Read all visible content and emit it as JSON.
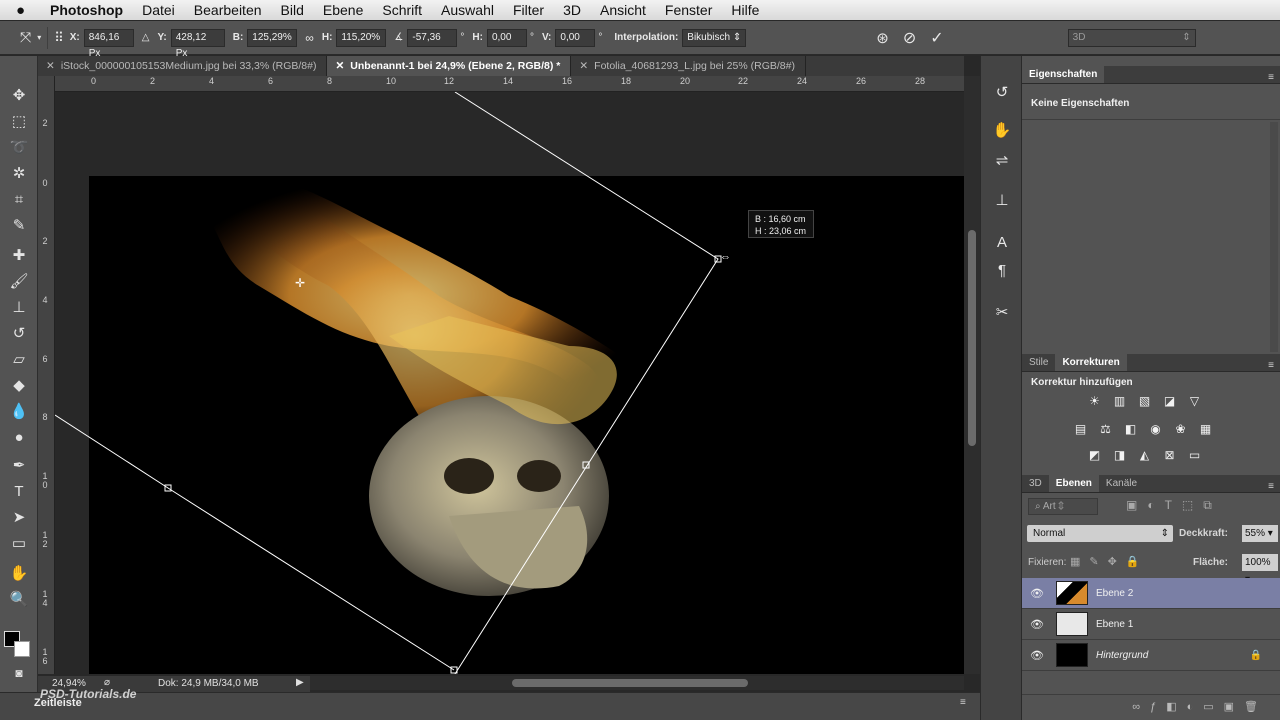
{
  "menubar": {
    "apple": "",
    "app": "Photoshop",
    "items": [
      "Datei",
      "Bearbeiten",
      "Bild",
      "Ebene",
      "Schrift",
      "Auswahl",
      "Filter",
      "3D",
      "Ansicht",
      "Fenster",
      "Hilfe"
    ]
  },
  "options": {
    "x_label": "X:",
    "x_value": "846,16 Px",
    "y_label": "Y:",
    "y_value": "428,12 Px",
    "b_label": "B:",
    "b_value": "125,29%",
    "h_label": "H:",
    "h_value": "115,20%",
    "angle_value": "-57,36",
    "deg": "°",
    "hskew_label": "H:",
    "hskew_value": "0,00",
    "vskew_label": "V:",
    "vskew_value": "0,00",
    "interp_label": "Interpolation:",
    "interp_value": "Bikubisch",
    "workspace": "3D"
  },
  "tabs": [
    {
      "label": "iStock_000000105153Medium.jpg bei 33,3% (RGB/8#)",
      "active": false
    },
    {
      "label": "Unbenannt-1 bei 24,9% (Ebene 2, RGB/8) *",
      "active": true
    },
    {
      "label": "Fotolia_40681293_L.jpg bei 25% (RGB/8#)",
      "active": false
    }
  ],
  "ruler_top": [
    "0",
    "2",
    "4",
    "6",
    "8",
    "10",
    "12",
    "14",
    "16",
    "18",
    "20",
    "22",
    "24",
    "26",
    "28"
  ],
  "ruler_left": [
    "2",
    "0",
    "2",
    "4",
    "6",
    "8",
    "1 0",
    "1 2",
    "1 4",
    "1 6"
  ],
  "transform_info": {
    "b": "B : 16,60 cm",
    "h": "H : 23,06 cm"
  },
  "status": {
    "zoom": "24,94%",
    "doc": "Dok: 24,9 MB/34,0 MB"
  },
  "timeline": {
    "label": "Zeitleiste"
  },
  "watermark": "PSD-Tutorials.de",
  "properties": {
    "tab": "Eigenschaften",
    "empty_text": "Keine Eigenschaften"
  },
  "adjustments": {
    "tabs": [
      "Stile",
      "Korrekturen"
    ],
    "title": "Korrektur hinzufügen"
  },
  "layers_panel": {
    "tabs": [
      "3D",
      "Ebenen",
      "Kanäle"
    ],
    "filter": "Art",
    "blend_mode": "Normal",
    "opacity_label": "Deckkraft:",
    "opacity": "55%",
    "lock_label": "Fixieren:",
    "fill_label": "Fläche:",
    "fill": "100%",
    "layers": [
      {
        "name": "Ebene 2",
        "selected": true
      },
      {
        "name": "Ebene 1",
        "selected": false
      },
      {
        "name": "Hintergrund",
        "selected": false,
        "locked": true
      }
    ]
  }
}
